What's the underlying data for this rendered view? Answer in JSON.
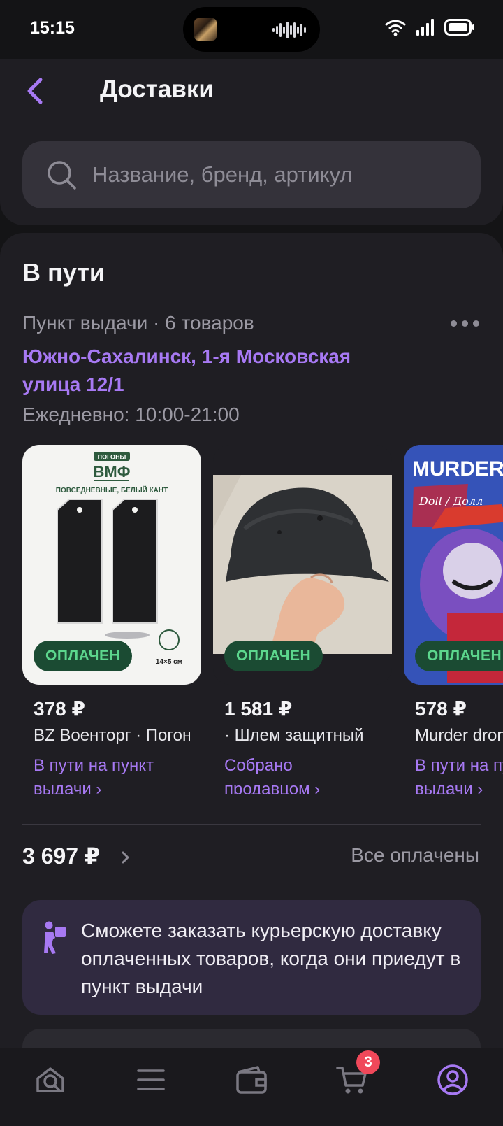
{
  "status_bar": {
    "time": "15:15"
  },
  "header": {
    "title": "Доставки",
    "search": {
      "placeholder": "Название, бренд, артикул"
    }
  },
  "delivery": {
    "section_title": "В пути",
    "pickup_meta": "Пункт выдачи · 6 товаров",
    "address": "Южно-Сахалинск, 1-я Московская улица 12/1",
    "hours": "Ежедневно: 10:00-21:00",
    "products": [
      {
        "price": "378 ₽",
        "name": "BZ Военторг · Погоны ВМФ",
        "status": "В пути на пункт выдачи ›",
        "badge": "ОПЛАЧЕН",
        "image_text": {
          "tag": "ПОГОНЫ",
          "title": "ВМФ",
          "subtitle": "ПОВСЕДНЕВНЫЕ, БЕЛЫЙ КАНТ",
          "size": "14×5 см"
        }
      },
      {
        "price": "1 581 ₽",
        "name": " · Шлем защитный",
        "status": "Собрано продавцом ›",
        "badge": "ОПЛАЧЕН"
      },
      {
        "price": "578 ₽",
        "name": "Murder drones",
        "status": "В пути на пункт выдачи ›",
        "badge": "ОПЛАЧЕН",
        "image_text": {
          "title": "MURDER D",
          "tag": "Doll / Долл"
        }
      }
    ],
    "total": "3 697 ₽",
    "total_status": "Все оплачены",
    "courier_info": "Сможете заказать курьерскую доставку оплаченных товаров, когда они приедут в пункт выдачи"
  },
  "bottom_nav": {
    "items": [
      "home-search",
      "catalog",
      "wallet",
      "cart",
      "profile"
    ],
    "cart_count": "3",
    "active": "profile"
  },
  "colors": {
    "background": "#141416",
    "surface": "#1f1e23",
    "accent": "#a779f3",
    "paid_badge_bg": "#1b4b33",
    "paid_badge_text": "#5cd68d",
    "cart_badge": "#f0485a",
    "info_box": "#302a40"
  }
}
